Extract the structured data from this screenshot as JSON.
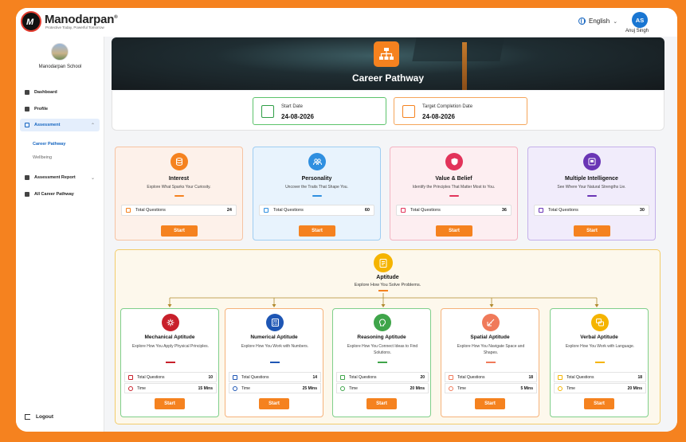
{
  "app": {
    "brand": "Manodarpan",
    "tagline": "Protective Today, Powerful Tomorrow",
    "language": "English",
    "user_initials": "AS",
    "user_name": "Anuj Singh"
  },
  "sidebar": {
    "school": "Manodarpan School",
    "items": [
      {
        "label": "Dashboard"
      },
      {
        "label": "Profile"
      },
      {
        "label": "Assessment"
      },
      {
        "label": "Assessment Report"
      },
      {
        "label": "All Career Pathway"
      }
    ],
    "sub_items": [
      {
        "label": "Career Pathway"
      },
      {
        "label": "Wellbeing"
      }
    ],
    "logout": "Logout"
  },
  "hero": {
    "title": "Career Pathway",
    "start_label": "Start Date",
    "start_value": "24-08-2026",
    "target_label": "Target Completion Date",
    "target_value": "24-08-2026"
  },
  "colors": {
    "accent": "#f5821f",
    "interest": "#f5821f",
    "personality": "#2f8fe0",
    "value": "#e2335a",
    "intelligence": "#6a35b5"
  },
  "cards": [
    {
      "title": "Interest",
      "desc": "Explore What Sparks Your Curiosity.",
      "q_label": "Total Questions",
      "q_value": "24",
      "button": "Start"
    },
    {
      "title": "Personality",
      "desc": "Uncover the Traits That Shape You.",
      "q_label": "Total Questions",
      "q_value": "60",
      "button": "Start"
    },
    {
      "title": "Value & Belief",
      "desc": "Identify the Principles That Matter Most to You.",
      "q_label": "Total Questions",
      "q_value": "36",
      "button": "Start"
    },
    {
      "title": "Multiple Intelligence",
      "desc": "See Where Your Natural Strengths Lie.",
      "q_label": "Total Questions",
      "q_value": "30",
      "button": "Start"
    }
  ],
  "aptitude": {
    "title": "Aptitude",
    "desc": "Explore How You Solve Problems.",
    "items": [
      {
        "title": "Mechanical Aptitude",
        "desc": "Explore How You Apply Physical Principles.",
        "q_label": "Total Questions",
        "q_value": "10",
        "t_label": "Time",
        "t_value": "15 Mins",
        "button": "Start"
      },
      {
        "title": "Numerical Aptitude",
        "desc": "Explore How You Work with Numbers.",
        "q_label": "Total Questions",
        "q_value": "14",
        "t_label": "Time",
        "t_value": "25 Mins",
        "button": "Start"
      },
      {
        "title": "Reasoning Aptitude",
        "desc": "Explore How You Connect Ideas to Find Solutions.",
        "q_label": "Total Questions",
        "q_value": "20",
        "t_label": "Time",
        "t_value": "20 Mins",
        "button": "Start"
      },
      {
        "title": "Spatial Aptitude",
        "desc": "Explore How You Navigate Space and Shapes.",
        "q_label": "Total Questions",
        "q_value": "18",
        "t_label": "Time",
        "t_value": "5 Mins",
        "button": "Start"
      },
      {
        "title": "Verbal Aptitude",
        "desc": "Explore How You Work with Language.",
        "q_label": "Total Questions",
        "q_value": "18",
        "t_label": "Time",
        "t_value": "20 Mins",
        "button": "Start"
      }
    ]
  }
}
